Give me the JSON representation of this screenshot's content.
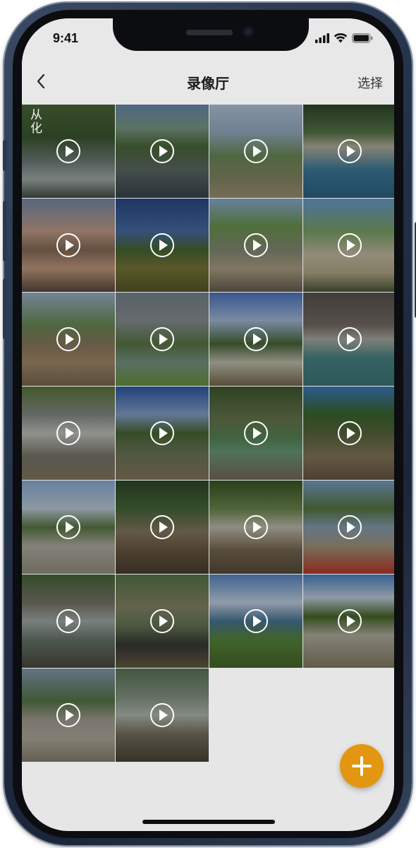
{
  "status_bar": {
    "time": "9:41",
    "icons": [
      "cellular-signal-icon",
      "wifi-icon",
      "battery-icon"
    ]
  },
  "nav": {
    "back_icon": "chevron-left-icon",
    "title": "录像厅",
    "select_label": "选择"
  },
  "grid": {
    "play_icon": "play-circle-icon",
    "videos": [
      {
        "scene": "waterfall",
        "bg": "linear-gradient(180deg,#4c6b3a 0%,#3d5a30 35%,#6f7f7a 60%,#a7b2b0 80%,#4a4f47 100%)",
        "badge": "从化"
      },
      {
        "scene": "river-rocks",
        "bg": "linear-gradient(180deg,#6f90b8 0%,#7ea08a 25%,#4e6c3a 45%,#5f6d6a 70%,#3a4650 100%)"
      },
      {
        "scene": "mountain-valley",
        "bg": "linear-gradient(180deg,#b8cde2 0%,#9ab3c8 30%,#6e8f5a 55%,#8b8c6a 80%,#a39674 100%)"
      },
      {
        "scene": "river-swimmers",
        "bg": "linear-gradient(180deg,#2f4a2a 0%,#5a7a4a 30%,#b9b6a4 45%,#3f7fa0 70%,#2e6685 100%)"
      },
      {
        "scene": "lake-sunset",
        "bg": "linear-gradient(180deg,#7c8fb0 0%,#c7a28c 35%,#8a6e5a 55%,#caa183 75%,#5a4a3e 100%)"
      },
      {
        "scene": "tents-meadow",
        "bg": "linear-gradient(180deg,#2a4c8c 0%,#4a6fa8 35%,#4a6a34 55%,#7c7a3a 75%,#5b5a2a 100%)"
      },
      {
        "scene": "stream-kids",
        "bg": "linear-gradient(180deg,#8fb2d8 0%,#6f9a52 30%,#8a8f78 55%,#b3a58a 75%,#6b6250 100%)"
      },
      {
        "scene": "camp-path",
        "bg": "linear-gradient(180deg,#6ea0d8 0%,#7fa86a 35%,#c9c1a8 60%,#b9ae8c 80%,#4a5a3a 100%)"
      },
      {
        "scene": "tent-pebbles",
        "bg": "linear-gradient(180deg,#9fb8cf 0%,#6e8f58 35%,#8e7d62 55%,#a88e6e 75%,#7d6a52 100%)"
      },
      {
        "scene": "cloudy-river",
        "bg": "linear-gradient(180deg,#7c8793 0%,#8c9598 30%,#5e7a48 55%,#7c9a8a 75%,#6c9a3a 100%)"
      },
      {
        "scene": "bamboo-tents",
        "bg": "linear-gradient(180deg,#4f7ac4 0%,#a9bfe0 30%,#4a6a3a 55%,#c9c6b4 75%,#7a6a50 100%)"
      },
      {
        "scene": "gorge-swim",
        "bg": "linear-gradient(180deg,#5a5450 0%,#7a7068 35%,#b0b0a8 50%,#4a8a8a 70%,#3e7a7a 100%)"
      },
      {
        "scene": "rock-falls",
        "bg": "linear-gradient(180deg,#5c7a3a 0%,#8a9088 30%,#c8cac4 50%,#7c7a6e 75%,#8a7c64 100%)"
      },
      {
        "scene": "shore-camp",
        "bg": "linear-gradient(180deg,#2e5ea8 0%,#8aa6d0 30%,#4a6a34 50%,#6e7a5a 70%,#8a7a60 100%)"
      },
      {
        "scene": "green-pool",
        "bg": "linear-gradient(180deg,#3f5c2e 0%,#6b7b50 35%,#5a8a5a 55%,#6fa07a 70%,#7a6e5c 100%)"
      },
      {
        "scene": "rocky-stream",
        "bg": "linear-gradient(180deg,#3f7ec2 0%,#3d6a2e 30%,#5a6a40 50%,#8a7a5c 75%,#6a5a44 100%)"
      },
      {
        "scene": "canopy-beach",
        "bg": "linear-gradient(180deg,#8eb4dc 0%,#c4d2e0 30%,#5c7c44 50%,#b6b4a8 70%,#9a9486 100%)"
      },
      {
        "scene": "camp-chairs",
        "bg": "linear-gradient(180deg,#2f4a2a 0%,#4a6a3a 30%,#8a7c64 55%,#6e5a40 75%,#4a3e30 100%)"
      },
      {
        "scene": "forest-canopy",
        "bg": "linear-gradient(180deg,#3a5a2a 0%,#6e8a4e 30%,#c8c4b4 50%,#7a6a50 75%,#5a4e3e 100%)"
      },
      {
        "scene": "hammock-lake",
        "bg": "linear-gradient(180deg,#7fa4cc 0%,#5a7a44 30%,#8aa4b8 50%,#a89a80 70%,#c0392b 100%)"
      },
      {
        "scene": "rapids-kids",
        "bg": "linear-gradient(180deg,#4a6a3a 0%,#7a7a6a 30%,#a8b0ac 50%,#6a7a6e 70%,#4e4a40 100%)"
      },
      {
        "scene": "creek-bag",
        "bg": "linear-gradient(180deg,#5a7a4a 0%,#8a8a6a 35%,#6a7a5a 55%,#3a3a36 75%,#6a5e48 100%)"
      },
      {
        "scene": "lakeside-field",
        "bg": "linear-gradient(180deg,#5a8ac8 0%,#c8d8ea 30%,#4a7a9a 50%,#5a8a3a 70%,#4a6a2e 100%)"
      },
      {
        "scene": "tarp-meadow",
        "bg": "linear-gradient(180deg,#4e86c8 0%,#c8d6e4 25%,#4a6a2a 45%,#b8b4a4 65%,#8a7e66 100%)"
      },
      {
        "scene": "gravel-bank",
        "bg": "linear-gradient(180deg,#8aa0b8 0%,#5a7a4a 35%,#a8a49a 55%,#b8b0a0 75%,#8a8474 100%)"
      },
      {
        "scene": "water-splash",
        "bg": "linear-gradient(180deg,#5a7a5a 0%,#8a9a8a 30%,#b8c0b4 50%,#7a7464 70%,#4e4638 100%)"
      }
    ]
  },
  "fab": {
    "icon": "plus-icon",
    "color": "#E3960F"
  }
}
